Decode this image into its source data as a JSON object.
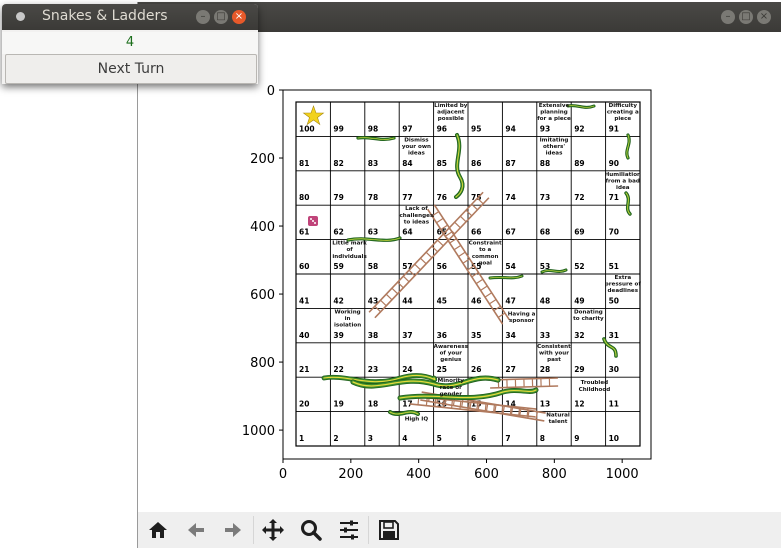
{
  "small_window": {
    "title": "Snakes & Ladders",
    "turn_value": "4",
    "next_turn_label": "Next Turn"
  },
  "plot": {
    "y_ticks": [
      "0",
      "200",
      "400",
      "600",
      "800",
      "1000"
    ],
    "x_ticks": [
      "0",
      "200",
      "400",
      "600",
      "800",
      "1000"
    ]
  },
  "board": {
    "squares": [
      "100",
      "99",
      "98",
      "97",
      "96",
      "95",
      "94",
      "93",
      "92",
      "91",
      "81",
      "82",
      "83",
      "84",
      "85",
      "86",
      "87",
      "88",
      "89",
      "90",
      "80",
      "79",
      "78",
      "77",
      "76",
      "75",
      "74",
      "73",
      "72",
      "71",
      "61",
      "62",
      "63",
      "64",
      "65",
      "66",
      "67",
      "68",
      "69",
      "70",
      "60",
      "59",
      "58",
      "57",
      "56",
      "55",
      "54",
      "53",
      "52",
      "51",
      "41",
      "42",
      "43",
      "44",
      "45",
      "46",
      "47",
      "48",
      "49",
      "50",
      "40",
      "39",
      "38",
      "37",
      "36",
      "35",
      "34",
      "33",
      "32",
      "31",
      "21",
      "22",
      "23",
      "24",
      "25",
      "26",
      "27",
      "28",
      "29",
      "30",
      "20",
      "19",
      "18",
      "17",
      "16",
      "15",
      "14",
      "13",
      "12",
      "11",
      "1",
      "2",
      "3",
      "4",
      "5",
      "6",
      "7",
      "8",
      "9",
      "10"
    ],
    "notes": {
      "n96": [
        "Limited by",
        "adjacent",
        "possible"
      ],
      "n93": [
        "Extensive",
        "planning",
        "for a piece"
      ],
      "n91": [
        "Difficulty",
        "creating a",
        "piece"
      ],
      "n84": [
        "Dismiss",
        "your own",
        "ideas"
      ],
      "n88": [
        "Imitating",
        "others'",
        "ideas"
      ],
      "n71": [
        "Humiliation",
        "from a bad",
        "idea"
      ],
      "n64": [
        "Lack of",
        "challenges",
        "to ideas"
      ],
      "n59": [
        "Little mark",
        "of",
        "individuals"
      ],
      "n55": [
        "Constraint",
        "to a",
        "common",
        "goal"
      ],
      "n50": [
        "Extra",
        "pressure of",
        "deadlines"
      ],
      "n39": [
        "Working",
        "in",
        "isolation"
      ],
      "n34": [
        "Having a",
        "sponsor"
      ],
      "n32": [
        "Donating",
        "to charity"
      ],
      "n25": [
        "Awareness",
        "of your",
        "genius"
      ],
      "n28": [
        "Consistent",
        "with your",
        "past"
      ],
      "n16": [
        "Minority",
        "race or",
        "gender"
      ],
      "n12": [
        "Troubled",
        "Childhood"
      ],
      "n4": [
        "High IQ"
      ],
      "n8": [
        "Natural",
        "talent"
      ]
    }
  },
  "toolbar": {
    "home": "home-icon",
    "back": "arrow-left-icon",
    "forward": "arrow-right-icon",
    "pan": "move-icon",
    "zoom": "magnifier-icon",
    "configure": "sliders-icon",
    "save": "floppy-icon"
  },
  "colors": {
    "titlebar": "#3d3c39",
    "ladder": "#b07a5e",
    "snake": "#3f8f2e",
    "turn_text": "#1b6e1b"
  }
}
